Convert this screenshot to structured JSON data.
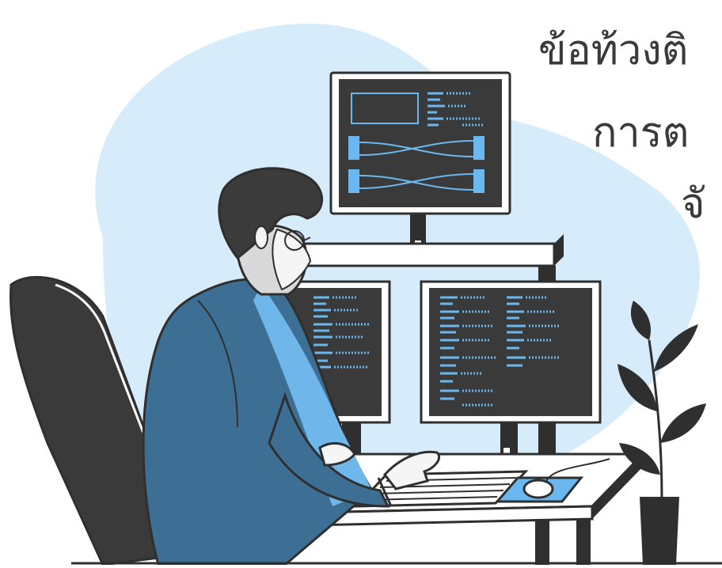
{
  "headline": {
    "line1": "ข้อท้วงติ",
    "line2": "การต",
    "line3": "จั"
  },
  "illustration": {
    "subject": "developer at multi-monitor workstation",
    "icons": [
      "person-icon",
      "office-chair-icon",
      "monitor-icon",
      "keyboard-icon",
      "mouse-icon",
      "desk-icon",
      "plant-icon"
    ],
    "colors": {
      "background_blob": "#d6ecfb",
      "outline": "#2f2f2f",
      "screen": "#3a3a3a",
      "screen_accent": "#6ab8ef",
      "shirt": "#3d6f95",
      "shirt_light": "#6fb6ea",
      "hair": "#3b3b3b",
      "skin": "#f5f5f5",
      "desk": "#ffffff",
      "plant": "#2f2f2f"
    }
  }
}
